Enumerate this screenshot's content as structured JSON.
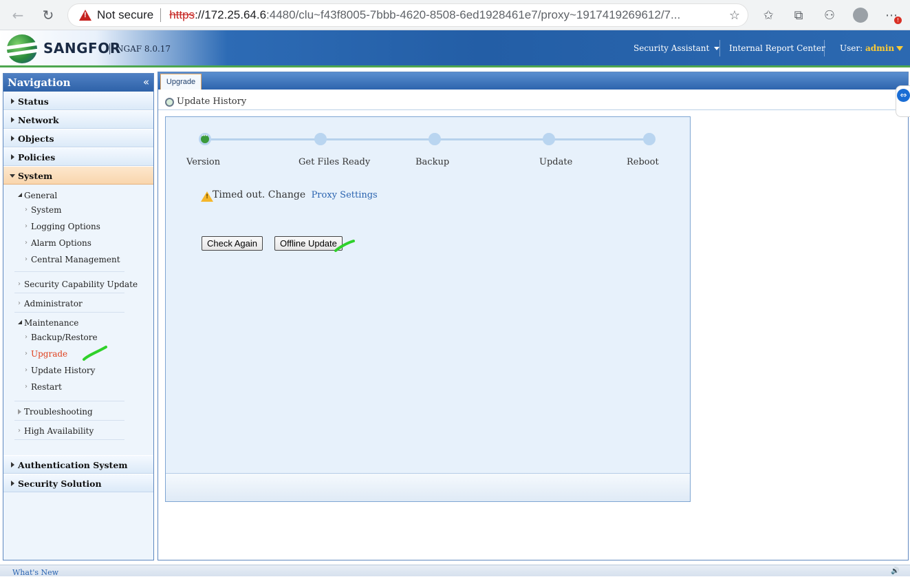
{
  "browser": {
    "back_icon": "←",
    "reload_icon": "↻",
    "not_secure": "Not secure",
    "url_scheme": "https",
    "url_host": "://172.25.64.6",
    "url_rest": ":4480/clu~f43f8005-7bbb-4620-8508-6ed1928461e7/proxy~1917419269612/7...",
    "star_icon": "☆",
    "favorites_icon": "✩",
    "collections_icon": "⧉",
    "extensions_icon": "⚇",
    "menu_icon": "⋯",
    "badge": "!"
  },
  "header": {
    "brand": "SANGFOR",
    "version": "NGAF 8.0.17",
    "security_assistant": "Security Assistant",
    "internal_report_center": "Internal Report Center",
    "user_label": "User:",
    "user_name": "admin"
  },
  "sidebar": {
    "title": "Navigation",
    "collapse_icon": "«",
    "sections": {
      "status": "Status",
      "network": "Network",
      "objects": "Objects",
      "policies": "Policies",
      "system": "System",
      "authentication_system": "Authentication System",
      "security_solution": "Security Solution"
    },
    "tree": {
      "general": "General",
      "general_system": "System",
      "logging_options": "Logging Options",
      "alarm_options": "Alarm Options",
      "central_management": "Central Management",
      "security_capability_update": "Security Capability Update",
      "administrator": "Administrator",
      "maintenance": "Maintenance",
      "backup_restore": "Backup/Restore",
      "upgrade": "Upgrade",
      "update_history": "Update History",
      "restart": "Restart",
      "troubleshooting": "Troubleshooting",
      "high_availability": "High Availability"
    }
  },
  "main": {
    "tab": "Upgrade",
    "subtitle": "Update History",
    "steps": [
      "Version",
      "Get Files Ready",
      "Backup",
      "Update",
      "Reboot"
    ],
    "current_step": "Version",
    "message": "Timed out. Change",
    "message_link": "Proxy Settings",
    "check_again": "Check Again",
    "offline_update": "Offline Update"
  },
  "status_bar": {
    "whats_new": "What's New"
  },
  "colors": {
    "accent_blue": "#2d64ad",
    "header_green": "#4da64f",
    "active_item": "#e0401d",
    "annotation": "#2fd12a"
  }
}
